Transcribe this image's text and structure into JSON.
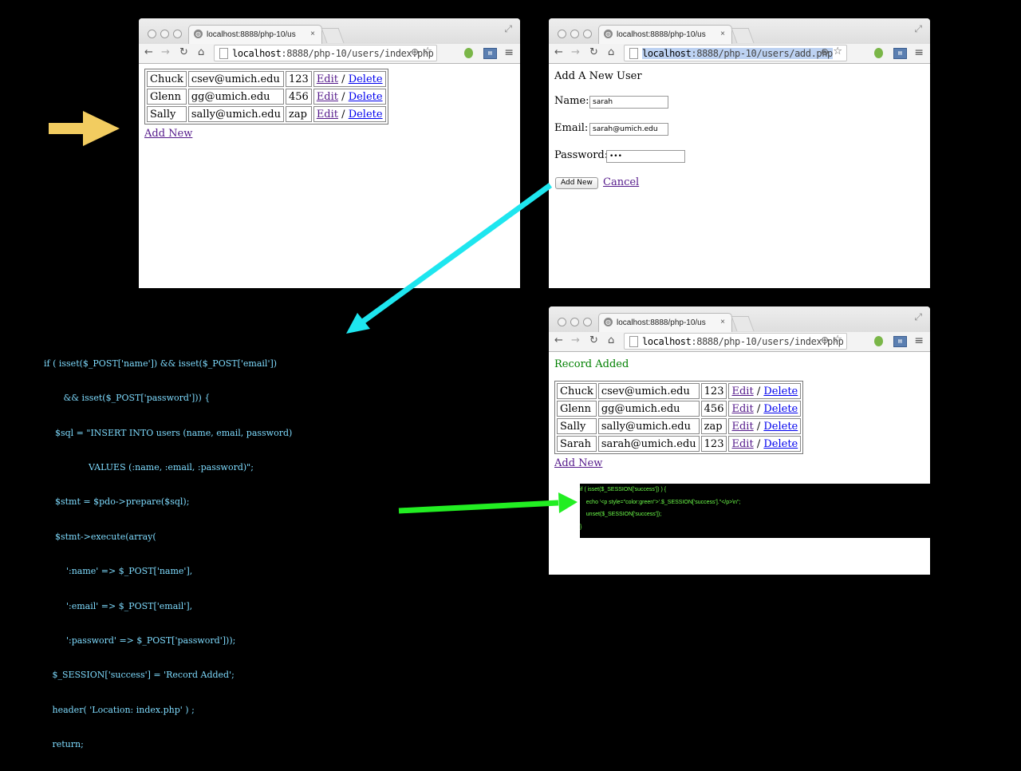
{
  "browser": {
    "tab_title": "localhost:8888/php-10/us",
    "tab_close": "×",
    "favicon": "globe-icon"
  },
  "window1": {
    "url_host": "localhost",
    "url_rest": ":8888/php-10/users/index.php",
    "rows": [
      {
        "name": "Chuck",
        "email": "csev@umich.edu",
        "pw": "123"
      },
      {
        "name": "Glenn",
        "email": "gg@umich.edu",
        "pw": "456"
      },
      {
        "name": "Sally",
        "email": "sally@umich.edu",
        "pw": "zap"
      }
    ],
    "edit_label": "Edit",
    "sep": "/",
    "delete_label": "Delete",
    "add_new": "Add New"
  },
  "window2": {
    "url_host": "localhost",
    "url_rest": ":8888/php-10/users/add.php",
    "heading": "Add A New User",
    "name_label": "Name:",
    "name_value": "sarah",
    "email_label": "Email:",
    "email_value": "sarah@umich.edu",
    "password_label": "Password:",
    "password_value": "•••",
    "add_button": "Add New",
    "cancel_link": "Cancel"
  },
  "window3": {
    "url_host": "localhost",
    "url_rest": ":8888/php-10/users/index.php",
    "flash": "Record Added",
    "flash_color": "#008000",
    "rows": [
      {
        "name": "Chuck",
        "email": "csev@umich.edu",
        "pw": "123"
      },
      {
        "name": "Glenn",
        "email": "gg@umich.edu",
        "pw": "456"
      },
      {
        "name": "Sally",
        "email": "sally@umich.edu",
        "pw": "zap"
      },
      {
        "name": "Sarah",
        "email": "sarah@umich.edu",
        "pw": "123"
      }
    ],
    "edit_label": "Edit",
    "sep": "/",
    "delete_label": "Delete",
    "add_new": "Add New"
  },
  "code_post": [
    "if ( isset($_POST['name']) && isset($_POST['email'])",
    "       && isset($_POST['password'])) {",
    "    $sql = \"INSERT INTO users (name, email, password)",
    "                VALUES (:name, :email, :password)\";",
    "    $stmt = $pdo->prepare($sql);",
    "    $stmt->execute(array(",
    "        ':name' => $_POST['name'],",
    "        ':email' => $_POST['email'],",
    "        ':password' => $_POST['password']));",
    "   $_SESSION['success'] = 'Record Added';",
    "   header( 'Location: index.php' ) ;",
    "   return;"
  ],
  "code_session": [
    "if ( isset($_SESSION['success']) ) {",
    "    echo '<p style=\"color:green\">'.$_SESSION['success'].\"</p>\\n\";",
    "    unset($_SESSION['success']);",
    "}"
  ],
  "colors": {
    "yellow_arrow": "#f2cc60",
    "cyan_arrow": "#1ee6ef",
    "green_arrow": "#22ee22",
    "code_cyan": "#7fdcff",
    "code_green": "#6dff4a"
  }
}
